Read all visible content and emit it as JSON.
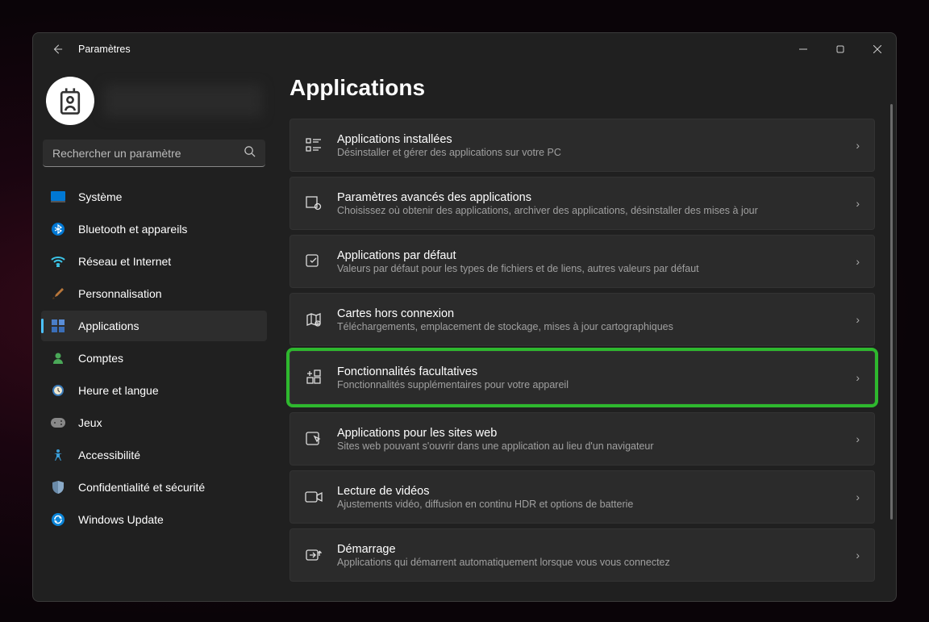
{
  "titlebar": {
    "title": "Paramètres"
  },
  "search": {
    "placeholder": "Rechercher un paramètre"
  },
  "sidebar": {
    "items": [
      {
        "label": "Système",
        "icon": "system"
      },
      {
        "label": "Bluetooth et appareils",
        "icon": "bluetooth"
      },
      {
        "label": "Réseau et Internet",
        "icon": "wifi"
      },
      {
        "label": "Personnalisation",
        "icon": "brush"
      },
      {
        "label": "Applications",
        "icon": "apps",
        "active": true
      },
      {
        "label": "Comptes",
        "icon": "account"
      },
      {
        "label": "Heure et langue",
        "icon": "time"
      },
      {
        "label": "Jeux",
        "icon": "games"
      },
      {
        "label": "Accessibilité",
        "icon": "access"
      },
      {
        "label": "Confidentialité et sécurité",
        "icon": "shield"
      },
      {
        "label": "Windows Update",
        "icon": "update"
      }
    ]
  },
  "page": {
    "title": "Applications",
    "cards": [
      {
        "title": "Applications installées",
        "desc": "Désinstaller et gérer des applications sur votre PC",
        "icon": "list"
      },
      {
        "title": "Paramètres avancés des applications",
        "desc": "Choisissez où obtenir des applications, archiver des applications, désinstaller des mises à jour",
        "icon": "settings-app"
      },
      {
        "title": "Applications par défaut",
        "desc": "Valeurs par défaut pour les types de fichiers et de liens, autres valeurs par défaut",
        "icon": "default-app"
      },
      {
        "title": "Cartes hors connexion",
        "desc": "Téléchargements, emplacement de stockage, mises à jour cartographiques",
        "icon": "map"
      },
      {
        "title": "Fonctionnalités facultatives",
        "desc": "Fonctionnalités supplémentaires pour votre appareil",
        "icon": "feature",
        "highlight": true
      },
      {
        "title": "Applications pour les sites web",
        "desc": "Sites web pouvant s'ouvrir dans une application au lieu d'un navigateur",
        "icon": "website"
      },
      {
        "title": "Lecture de vidéos",
        "desc": "Ajustements vidéo, diffusion en continu HDR et options de batterie",
        "icon": "video"
      },
      {
        "title": "Démarrage",
        "desc": "Applications qui démarrent automatiquement lorsque vous vous connectez",
        "icon": "startup"
      }
    ]
  }
}
